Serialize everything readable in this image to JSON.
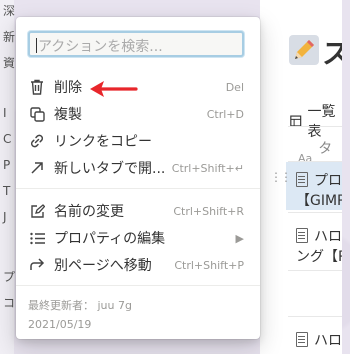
{
  "search": {
    "placeholder": "アクションを検索..."
  },
  "menu": {
    "items": [
      {
        "label": "削除",
        "shortcut": "Del",
        "icon": "trash-icon"
      },
      {
        "label": "複製",
        "shortcut": "Ctrl+D",
        "icon": "duplicate-icon"
      },
      {
        "label": "リンクをコピー",
        "shortcut": "",
        "icon": "link-icon"
      },
      {
        "label": "新しいタブで開...",
        "shortcut": "Ctrl+Shift+↵",
        "icon": "open-new-tab-icon"
      },
      {
        "label": "名前の変更",
        "shortcut": "Ctrl+Shift+R",
        "icon": "rename-icon"
      },
      {
        "label": "プロパティの編集",
        "shortcut": "",
        "icon": "list-icon"
      },
      {
        "label": "別ページへ移動",
        "shortcut": "Ctrl+Shift+P",
        "icon": "move-icon"
      }
    ],
    "last_edited_label": "最終更新者： juu 7g",
    "last_edited_date": "2021/05/19"
  },
  "page": {
    "title_fragment": "ス",
    "view_label": "一覧表",
    "property_label": "タイ",
    "rows": [
      {
        "line1": "プロ",
        "line2": "【GIMP】"
      },
      {
        "line1": "ハロ",
        "line2": "ング【Py"
      },
      {
        "line1": "ハロ"
      }
    ]
  },
  "sidebar": {
    "glyphs": [
      "深",
      "新",
      "資",
      "I",
      "C",
      "P",
      "T",
      "J",
      "プ",
      "コ"
    ]
  },
  "colors": {
    "annotation_arrow": "#e8262b",
    "focus_ring": "#a7cde3",
    "row_highlight": "#dce8f4"
  }
}
